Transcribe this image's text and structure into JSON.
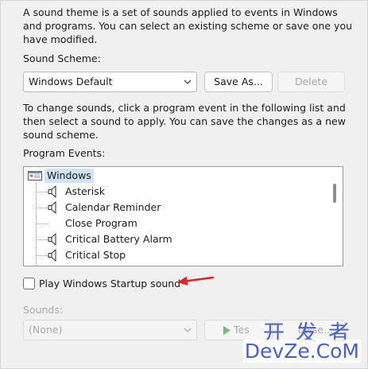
{
  "intro": "A sound theme is a set of sounds applied to events in Windows and programs.  You can select an existing scheme or save one you have modified.",
  "scheme": {
    "label": "Sound Scheme:",
    "selected": "Windows Default",
    "save_as_label": "Save As...",
    "delete_label": "Delete"
  },
  "instructions": "To change sounds, click a program event in the following list and then select a sound to apply.  You can save the changes as a new sound scheme.",
  "events": {
    "label": "Program Events:",
    "group": "Windows",
    "items": [
      {
        "label": "Asterisk",
        "icon": "speaker-icon"
      },
      {
        "label": "Calendar Reminder",
        "icon": "speaker-icon"
      },
      {
        "label": "Close Program",
        "icon": ""
      },
      {
        "label": "Critical Battery Alarm",
        "icon": "speaker-icon"
      },
      {
        "label": "Critical Stop",
        "icon": "speaker-icon"
      }
    ]
  },
  "startup": {
    "label": "Play Windows Startup sound",
    "checked": false
  },
  "sounds": {
    "label": "Sounds:",
    "selected": "(None)",
    "test_label": "Tes",
    "browse_label": "owse..."
  },
  "watermark": {
    "line1": "开发者",
    "line2": "DevZe.CoM"
  },
  "colors": {
    "arrow": "#e0262a",
    "watermark": "#4a60c4",
    "selection": "#cde3f7"
  }
}
